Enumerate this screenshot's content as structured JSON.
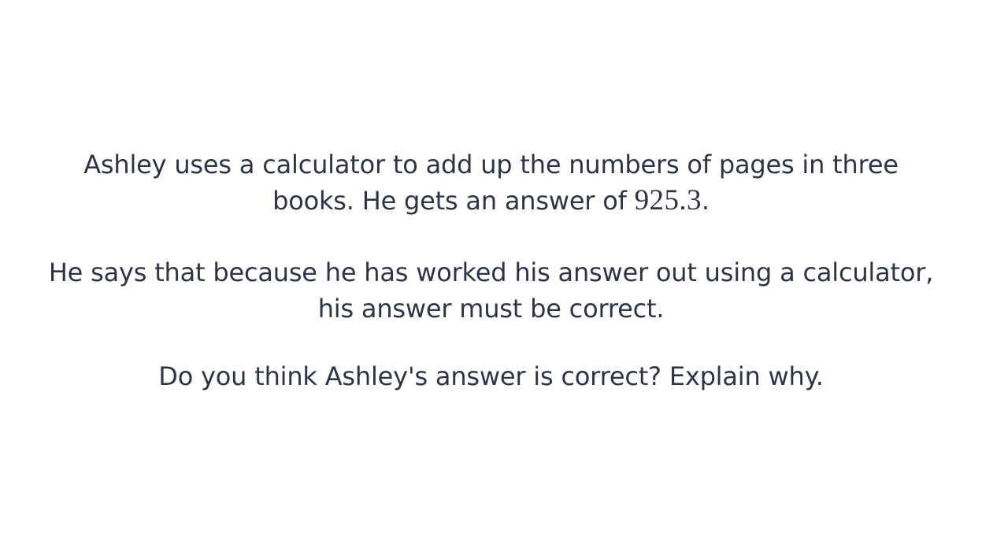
{
  "question": {
    "paragraph_1": {
      "line_1": "Ashley uses a calculator to add up the numbers of pages in three",
      "line_2_prefix": "books. He gets an answer of ",
      "line_2_math": "925.3",
      "line_2_suffix": "."
    },
    "paragraph_2": {
      "line_1": "He says that because he has worked his answer out using a calculator,",
      "line_2": "his answer must be correct."
    },
    "paragraph_3": {
      "line_1": "Do you think Ashley's answer is correct? Explain why."
    }
  }
}
